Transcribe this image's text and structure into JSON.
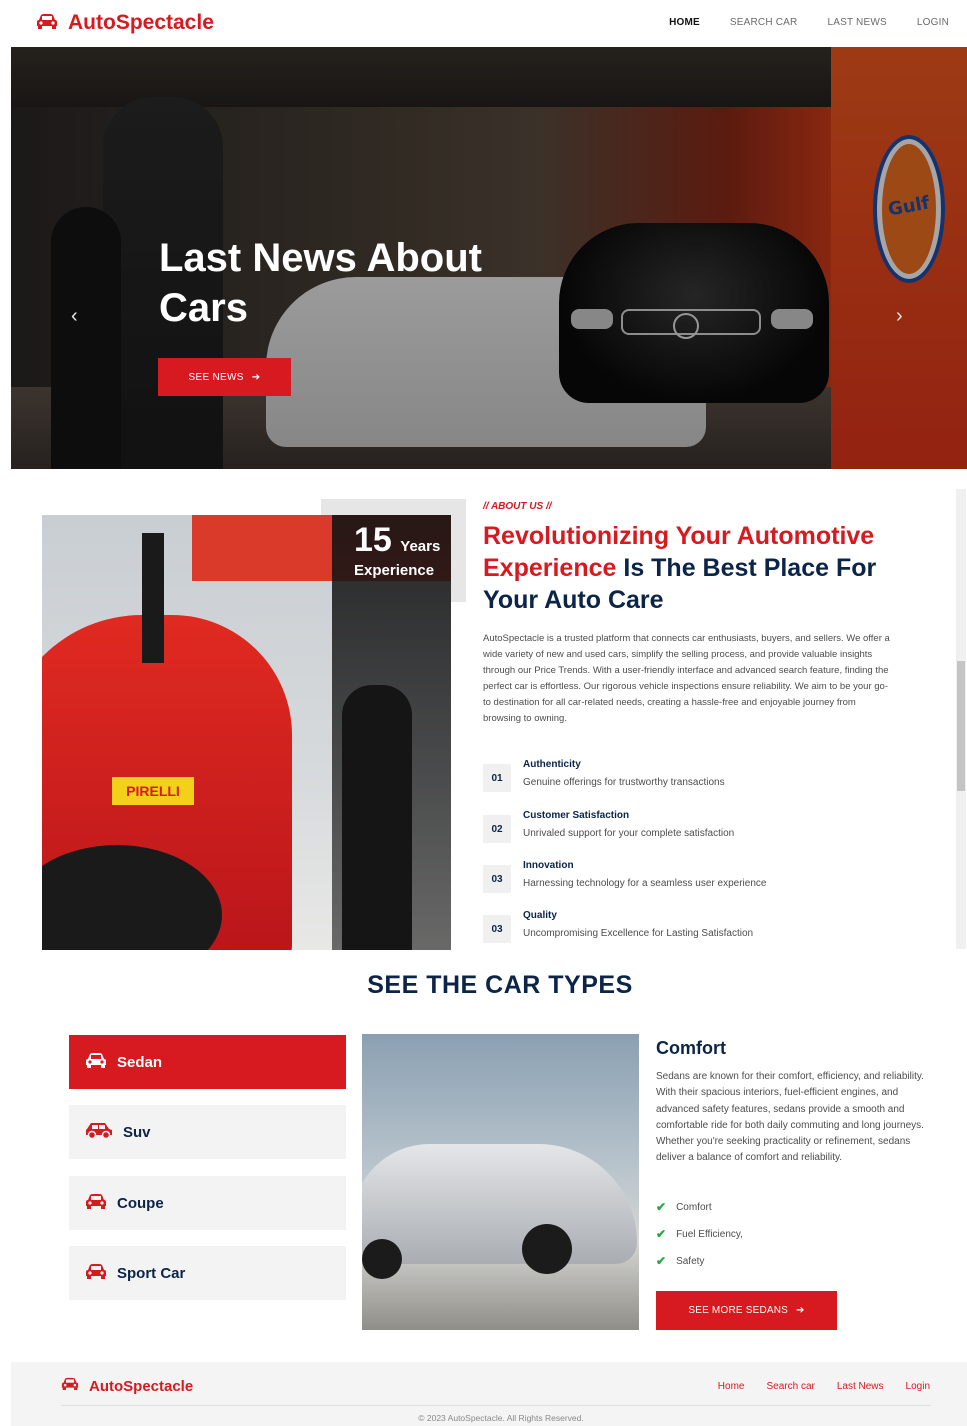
{
  "brand": {
    "name": "AutoSpectacle",
    "color": "#d71920"
  },
  "nav": {
    "items": [
      "HOME",
      "SEARCH CAR",
      "LAST NEWS",
      "LOGIN"
    ],
    "active": "HOME"
  },
  "hero": {
    "title": "Last News About Cars",
    "cta": "SEE NEWS",
    "left_arrow": "‹",
    "right_arrow": "›",
    "gulf_sign": "Gulf"
  },
  "about": {
    "years_num": "15",
    "years_label": "Years",
    "experience_label": "Experience",
    "pirelli": "PIRELLI",
    "tag": "// ABOUT US //",
    "title_red": "Revolutionizing Your Automotive Experience",
    "title_navy": " Is The Best Place For Your Auto Care",
    "body": "AutoSpectacle is a trusted platform that connects car enthusiasts, buyers, and sellers. We offer a wide variety of new and used cars, simplify the selling process, and provide valuable insights through our Price Trends. With a user-friendly interface and advanced search feature, finding the perfect car is effortless. Our rigorous vehicle inspections ensure reliability. We aim to be your go-to destination for all car-related needs, creating a hassle-free and enjoyable journey from browsing to owning.",
    "features": [
      {
        "num": "01",
        "title": "Authenticity",
        "desc": "Genuine offerings for trustworthy transactions"
      },
      {
        "num": "02",
        "title": "Customer Satisfaction",
        "desc": "Unrivaled support for your complete satisfaction"
      },
      {
        "num": "03",
        "title": "Innovation",
        "desc": "Harnessing technology for a seamless user experience"
      },
      {
        "num": "03",
        "title": "Quality",
        "desc": "Uncompromising Excellence for Lasting Satisfaction"
      }
    ]
  },
  "types": {
    "title": "SEE THE CAR TYPES",
    "items": [
      {
        "label": "Sedan",
        "icon": "car-icon",
        "active": true
      },
      {
        "label": "Suv",
        "icon": "suv-icon",
        "active": false
      },
      {
        "label": "Coupe",
        "icon": "car-icon",
        "active": false
      },
      {
        "label": "Sport Car",
        "icon": "car-icon",
        "active": false
      }
    ],
    "detail": {
      "heading": "Comfort",
      "body": "Sedans are known for their comfort, efficiency, and reliability. With their spacious interiors, fuel-efficient engines, and advanced safety features, sedans provide a smooth and comfortable ride for both daily commuting and long journeys. Whether you're seeking practicality or refinement, sedans deliver a balance of comfort and reliability.",
      "checks": [
        "Comfort",
        "Fuel Efficiency,",
        "Safety"
      ],
      "cta": "SEE MORE SEDANS"
    }
  },
  "footer": {
    "brand": "AutoSpectacle",
    "links": [
      "Home",
      "Search car",
      "Last News",
      "Login"
    ],
    "copyright": "© 2023 AutoSpectacle. All Rights Reserved."
  }
}
